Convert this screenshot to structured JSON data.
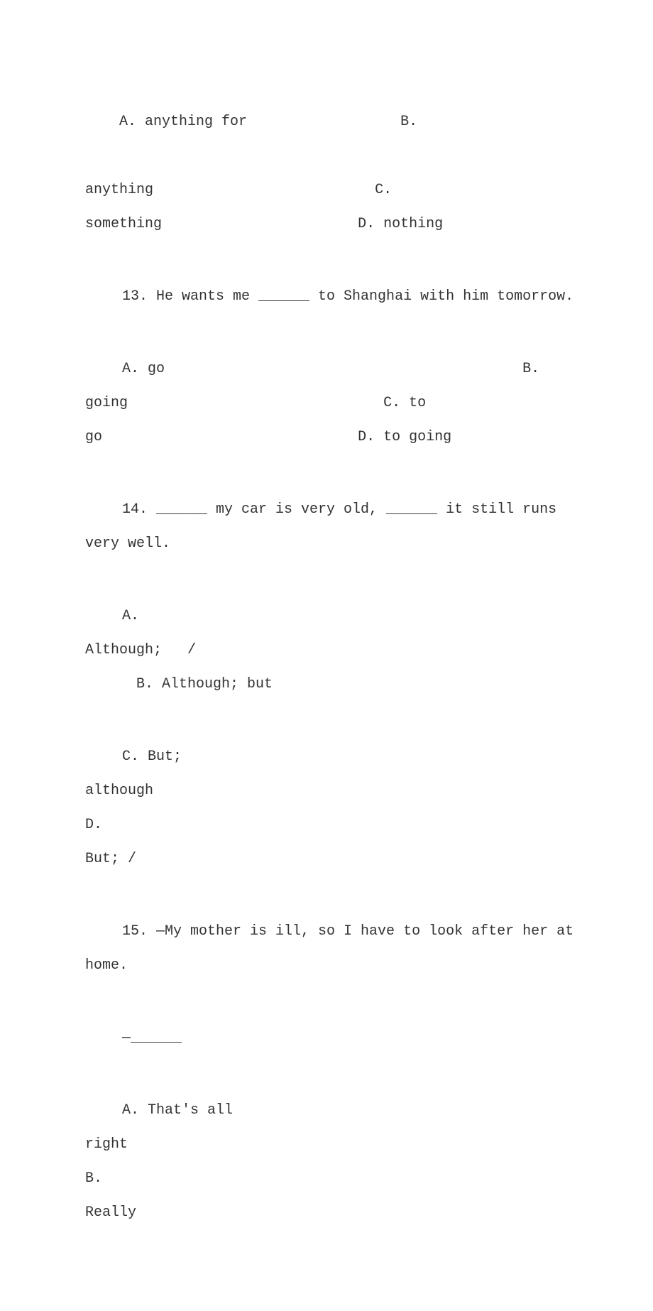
{
  "q12": {
    "optA_label": "A. anything for",
    "optB_label": "B.",
    "line2": "anything                          C.",
    "line3": "something                       D. nothing"
  },
  "q13": {
    "stem": "13. He wants me ______ to Shanghai with him tomorrow.",
    "line1": "A. go                                          B.",
    "line2": "going                              C. to",
    "line3": "go                              D. to going"
  },
  "q14": {
    "stem": "14. ______ my car is very old, ______ it still runs very well.",
    "line1": "A.",
    "line2": "Although;   /                                                              ",
    "line3": "      B. Although; but",
    "line4": "C. But;",
    "line5": "although                                                    D.",
    "line6": "But; /"
  },
  "q15": {
    "stem": "15. —My mother is ill, so I have to look after her at home.",
    "resp": "—______",
    "line1": "A. That's all",
    "line2": "right                                                   B.",
    "line3": "Really"
  }
}
